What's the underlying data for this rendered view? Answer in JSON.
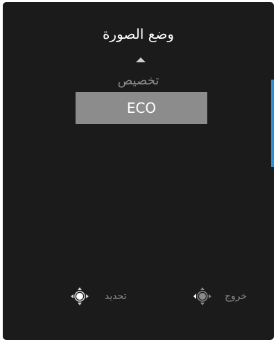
{
  "menu": {
    "title": "وضع الصورة",
    "options": [
      "تخصيص",
      "ECO"
    ],
    "selected_option": "ECO"
  },
  "footer": {
    "select_label": "تحديد",
    "exit_label": "خروج"
  },
  "colors": {
    "panel": "#1b1b1b",
    "highlight": "#8c8c8c",
    "accent": "#2a90d6"
  },
  "icons": {
    "select": "joystick-press-icon",
    "exit": "joystick-left-icon",
    "up": "up-arrow-icon"
  }
}
